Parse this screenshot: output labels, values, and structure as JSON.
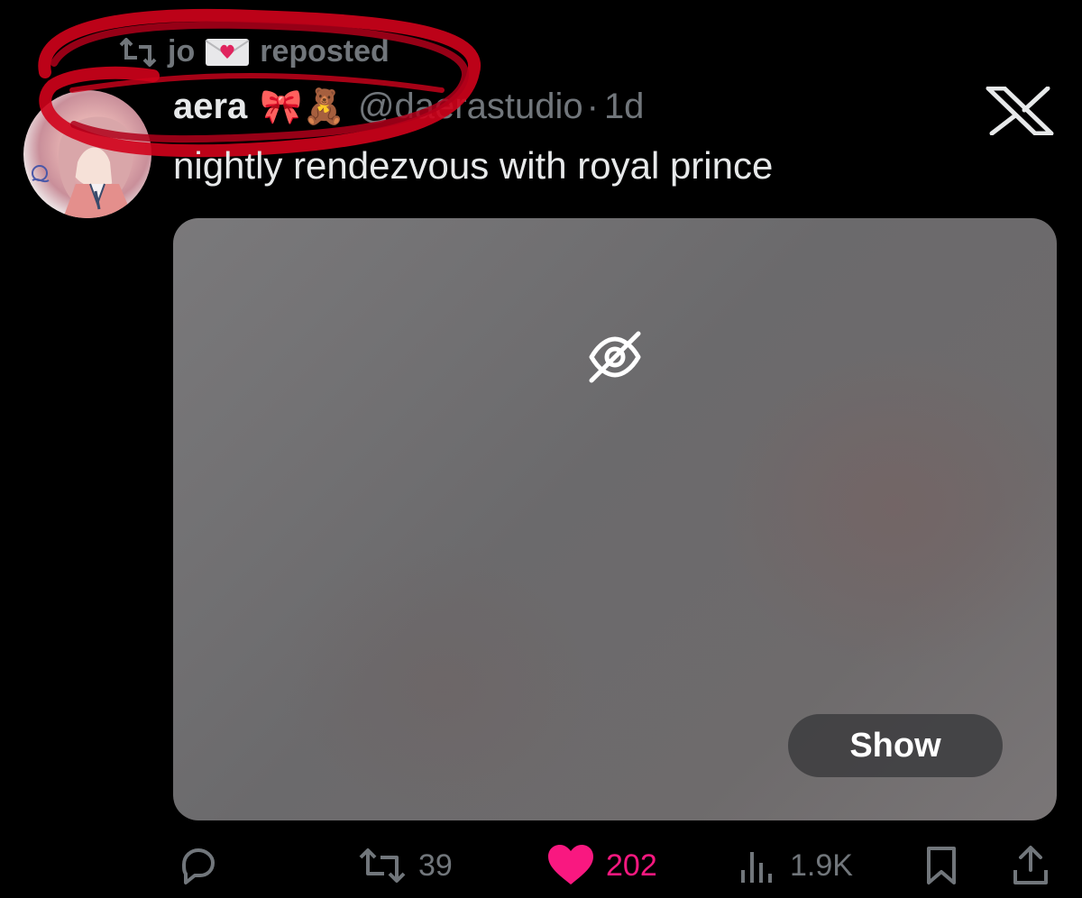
{
  "repost": {
    "user": "jo",
    "label": "reposted",
    "icon": "repost-icon",
    "emoji_icon": "love-letter-icon"
  },
  "tweet": {
    "author_name": "aera",
    "author_emoji": "🎀🧸",
    "handle": "@daerastudio",
    "separator": "·",
    "time": "1d",
    "text": "nightly rendezvous with royal prince"
  },
  "media": {
    "hidden_icon": "eye-off-icon",
    "show_label": "Show"
  },
  "actions": {
    "reply": {
      "icon": "reply-icon",
      "count": ""
    },
    "retweet": {
      "icon": "retweet-icon",
      "count": "39"
    },
    "like": {
      "icon": "heart-icon",
      "count": "202",
      "color": "#f91880"
    },
    "views": {
      "icon": "views-icon",
      "count": "1.9K"
    },
    "bookmark": {
      "icon": "bookmark-icon"
    },
    "share": {
      "icon": "share-icon"
    }
  },
  "colors": {
    "background": "#000000",
    "text": "#e7e9ea",
    "muted": "#71767b",
    "like": "#f91880",
    "scribble": "#d0021b"
  }
}
